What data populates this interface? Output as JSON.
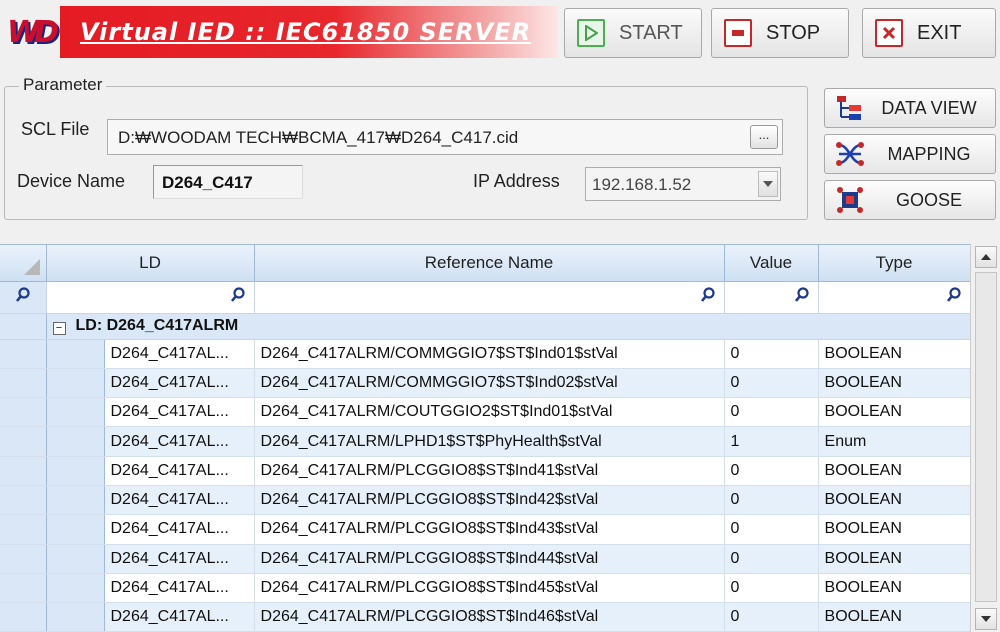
{
  "header": {
    "logo_text": "WD",
    "title": "Virtual IED :: IEC61850 SERVER",
    "start_label": "START",
    "stop_label": "STOP",
    "exit_label": "EXIT"
  },
  "parameter": {
    "legend": "Parameter",
    "scl_label": "SCL File",
    "scl_value": "D:₩WOODAM TECH₩BCMA_417₩D264_C417.cid",
    "browse_label": "...",
    "device_label": "Device Name",
    "device_value": "D264_C417",
    "ip_label": "IP Address",
    "ip_value": "192.168.1.52"
  },
  "side_buttons": {
    "data_view": "DATA VIEW",
    "mapping": "MAPPING",
    "goose": "GOOSE"
  },
  "grid": {
    "columns": [
      "LD",
      "Reference Name",
      "Value",
      "Type"
    ],
    "group_label": "LD: D264_C417ALRM",
    "group_expander": "−",
    "rows": [
      {
        "ld": "D264_C417AL...",
        "ref": "D264_C417ALRM/COMMGGIO7$ST$Ind01$stVal",
        "value": "0",
        "type": "BOOLEAN"
      },
      {
        "ld": "D264_C417AL...",
        "ref": "D264_C417ALRM/COMMGGIO7$ST$Ind02$stVal",
        "value": "0",
        "type": "BOOLEAN"
      },
      {
        "ld": "D264_C417AL...",
        "ref": "D264_C417ALRM/COUTGGIO2$ST$Ind01$stVal",
        "value": "0",
        "type": "BOOLEAN"
      },
      {
        "ld": "D264_C417AL...",
        "ref": "D264_C417ALRM/LPHD1$ST$PhyHealth$stVal",
        "value": "1",
        "type": "Enum"
      },
      {
        "ld": "D264_C417AL...",
        "ref": "D264_C417ALRM/PLCGGIO8$ST$Ind41$stVal",
        "value": "0",
        "type": "BOOLEAN"
      },
      {
        "ld": "D264_C417AL...",
        "ref": "D264_C417ALRM/PLCGGIO8$ST$Ind42$stVal",
        "value": "0",
        "type": "BOOLEAN"
      },
      {
        "ld": "D264_C417AL...",
        "ref": "D264_C417ALRM/PLCGGIO8$ST$Ind43$stVal",
        "value": "0",
        "type": "BOOLEAN"
      },
      {
        "ld": "D264_C417AL...",
        "ref": "D264_C417ALRM/PLCGGIO8$ST$Ind44$stVal",
        "value": "0",
        "type": "BOOLEAN"
      },
      {
        "ld": "D264_C417AL...",
        "ref": "D264_C417ALRM/PLCGGIO8$ST$Ind45$stVal",
        "value": "0",
        "type": "BOOLEAN"
      },
      {
        "ld": "D264_C417AL...",
        "ref": "D264_C417ALRM/PLCGGIO8$ST$Ind46$stVal",
        "value": "0",
        "type": "BOOLEAN"
      }
    ]
  },
  "colors": {
    "banner_red": "#e41b23",
    "grid_header": "#cfe0f3",
    "row_alt": "#e6f0fa",
    "start_green": "#4caf50",
    "stop_red": "#c62828"
  }
}
